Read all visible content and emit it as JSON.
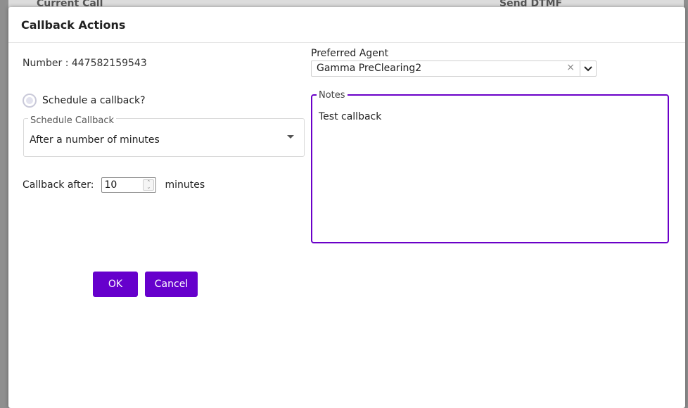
{
  "backdrop": {
    "left_text": "Current Call",
    "right_text": "Send DTMF"
  },
  "dialog": {
    "title": "Callback Actions"
  },
  "number": {
    "label": "Number :",
    "value": "447582159543"
  },
  "schedule": {
    "radio_label": "Schedule a callback?",
    "select_legend": "Schedule Callback",
    "select_value": "After a number of minutes"
  },
  "callback_after": {
    "label": "Callback after:",
    "value": "10",
    "unit": "minutes"
  },
  "preferred_agent": {
    "label": "Preferred Agent",
    "value": "Gamma PreClearing2"
  },
  "notes": {
    "legend": "Notes",
    "value": "Test callback"
  },
  "buttons": {
    "ok": "OK",
    "cancel": "Cancel"
  },
  "colors": {
    "accent": "#6600cc",
    "notes_border": "#6a00c8"
  },
  "icons": {
    "clear": "close-icon",
    "agent_dropdown": "chevron-down-icon",
    "schedule_dropdown": "caret-down-icon"
  }
}
